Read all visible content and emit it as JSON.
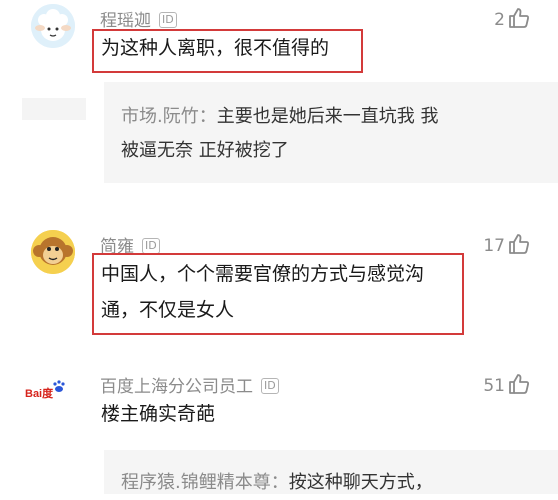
{
  "comments": [
    {
      "username": "程瑶迦",
      "id_badge": "ID",
      "likes": "2",
      "text": "为这种人离职，很不值得的",
      "reply": {
        "user": "市场.阮竹",
        "sep": "：",
        "line1": "主要也是她后来一直坑我 我",
        "line2": "被逼无奈 正好被挖了"
      }
    },
    {
      "username": "简雍",
      "id_badge": "ID",
      "likes": "17",
      "text_line1": "中国人，个个需要官僚的方式与感觉沟",
      "text_line2": "通，不仅是女人"
    },
    {
      "username": "百度上海分公司员工",
      "id_badge": "ID",
      "likes": "51",
      "text": "楼主确实奇葩",
      "avatar_text": "Bai度",
      "reply": {
        "user": "程序猿.锦鲤精本尊",
        "sep": "：",
        "line1": "按这种聊天方式，"
      }
    }
  ],
  "icons": {
    "like": "thumbs-up-icon"
  },
  "colors": {
    "highlight": "#d33a3a",
    "username": "#8b8b8b",
    "reply_bg": "#f5f5f5"
  }
}
